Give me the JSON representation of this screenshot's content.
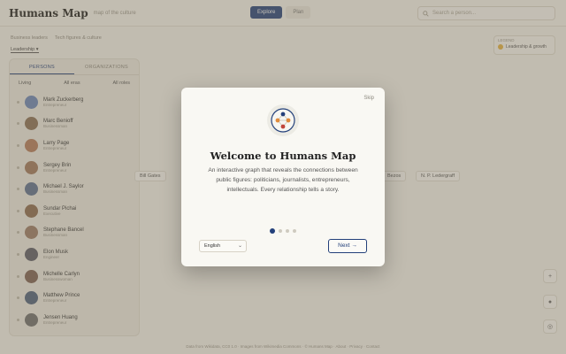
{
  "header": {
    "logo": "Humans Map",
    "tagline": "map of the culture",
    "modes": [
      "Explore",
      "Plan"
    ],
    "search_placeholder": "Search a person..."
  },
  "breadcrumbs": [
    "Business leaders",
    "Tech figures & culture"
  ],
  "crumb_active": "Leadership ▾",
  "sidebar": {
    "tabs": [
      "PERSONS",
      "ORGANIZATIONS"
    ],
    "filters": [
      "Living",
      "All eras",
      "All roles"
    ],
    "people": [
      {
        "name": "Mark Zuckerberg",
        "role": "Entrepreneur",
        "color": "#6a86b8"
      },
      {
        "name": "Marc Benioff",
        "role": "Businessman",
        "color": "#8a6f55"
      },
      {
        "name": "Larry Page",
        "role": "Entrepreneur",
        "color": "#b57b5a"
      },
      {
        "name": "Sergey Brin",
        "role": "Entrepreneur",
        "color": "#a0785c"
      },
      {
        "name": "Michael J. Saylor",
        "role": "Businessman",
        "color": "#5c6f8f"
      },
      {
        "name": "Sundar Pichai",
        "role": "Executive",
        "color": "#8c6a4f"
      },
      {
        "name": "Stephane Bancel",
        "role": "Businessman",
        "color": "#9b7b66"
      },
      {
        "name": "Elon Musk",
        "role": "Engineer",
        "color": "#5b5b66"
      },
      {
        "name": "Michelle Carlyn",
        "role": "Businesswoman",
        "color": "#7d5f52"
      },
      {
        "name": "Matthew Prince",
        "role": "Entrepreneur",
        "color": "#4d5f7a"
      },
      {
        "name": "Jensen Huang",
        "role": "Entrepreneur",
        "color": "#6d6d6d"
      }
    ]
  },
  "legend": {
    "title": "LEGEND",
    "item": "Leadership & growth"
  },
  "nodes": [
    "Bill Gates",
    "Bezos",
    "N. P. Ledergraff"
  ],
  "controls": [
    "+",
    "●",
    "◎"
  ],
  "footer": "Data from Wikidata, CC0 1.0 · Images from Wikimedia Commons · © Humans Map · About · Privacy · Contact",
  "modal": {
    "skip": "Skip",
    "title": "Welcome to Humans Map",
    "description": "An interactive graph that reveals the connections between public figures: politicians, journalists, entrepreneurs, intellectuals. Every relationship tells a story.",
    "language": "English",
    "next": "Next →",
    "step": 1,
    "steps": 4
  },
  "colors": {
    "accent": "#23407a",
    "node_orange": "#e08b3c",
    "node_red": "#c0453a"
  }
}
